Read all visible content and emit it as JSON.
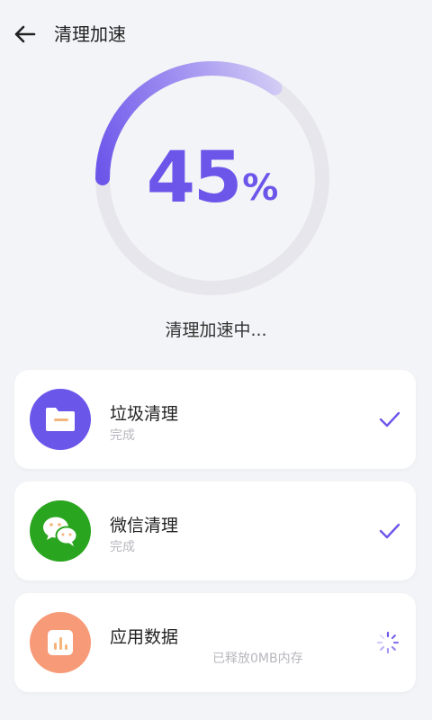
{
  "header": {
    "title": "清理加速",
    "back_icon": "arrow-left-icon"
  },
  "progress": {
    "value": 45,
    "unit": "%",
    "status_text": "清理加速中..."
  },
  "colors": {
    "accent": "#6c56ea",
    "track": "#e7e6ec",
    "junk_icon_bg": "#6a57ea",
    "wechat_icon_bg": "#2aa51f",
    "app_icon_bg": "#f79a78"
  },
  "items": [
    {
      "name": "垃圾清理",
      "status": "完成",
      "icon": "folder-icon",
      "state_icon": "check-icon"
    },
    {
      "name": "微信清理",
      "status": "完成",
      "icon": "wechat-icon",
      "state_icon": "check-icon"
    },
    {
      "name": "应用数据",
      "status": "已释放0MB内存",
      "icon": "bar-chart-icon",
      "state_icon": "loading-spinner-icon"
    }
  ]
}
